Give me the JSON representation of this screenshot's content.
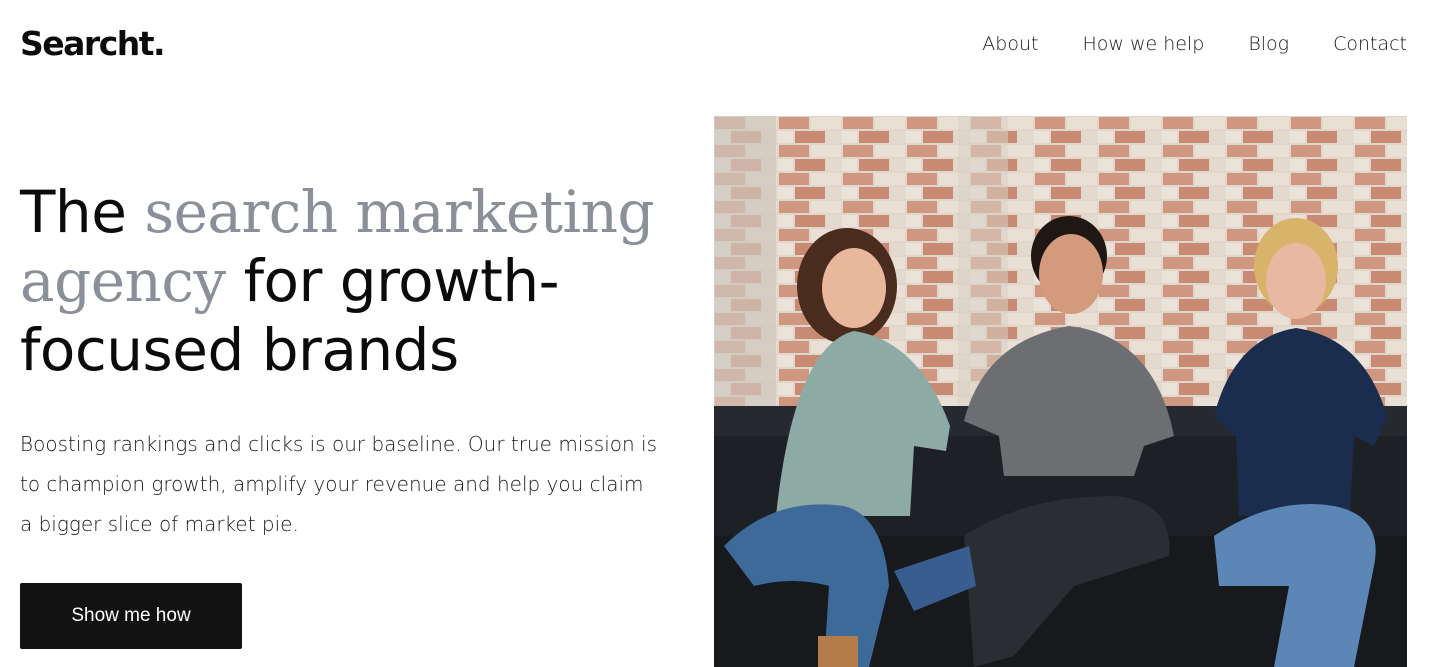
{
  "brand": {
    "logo_text": "Searcht."
  },
  "nav": {
    "items": [
      {
        "label": "About"
      },
      {
        "label": "How we help"
      },
      {
        "label": "Blog"
      },
      {
        "label": "Contact"
      }
    ]
  },
  "hero": {
    "title_part1": "The ",
    "title_muted1": "search marketing",
    "title_muted2": "agency",
    "title_part2": " for growth-focused brands",
    "lead": "Boosting rankings and clicks is our baseline. Our true mission is to champion growth, amplify your revenue and help you claim a bigger slice of market pie.",
    "cta_label": "Show me how"
  },
  "colors": {
    "text": "#0b0b0b",
    "muted_title": "#8b8f99",
    "cta_bg": "#121212",
    "cta_text": "#ffffff"
  }
}
